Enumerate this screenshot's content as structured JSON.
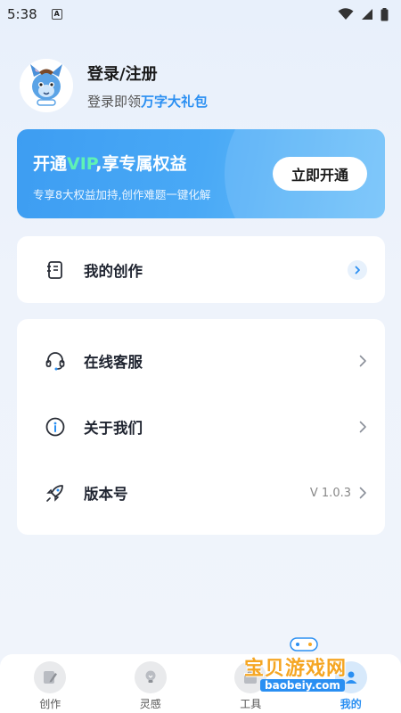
{
  "status_bar": {
    "time": "5:38",
    "notification_icon": "A"
  },
  "profile": {
    "title": "登录/注册",
    "subtitle_prefix": "登录即领",
    "subtitle_highlight": "万字大礼包"
  },
  "vip_card": {
    "title_prefix": "开通",
    "title_vip": "VIP",
    "title_suffix": ",享专属权益",
    "description": "专享8大权益加持,创作难题一键化解",
    "button_label": "立即开通"
  },
  "menu_primary": [
    {
      "label": "我的创作",
      "icon": "notebook-icon"
    }
  ],
  "menu_secondary": [
    {
      "label": "在线客服",
      "icon": "headset-icon"
    },
    {
      "label": "关于我们",
      "icon": "info-icon"
    },
    {
      "label": "版本号",
      "icon": "rocket-icon",
      "value": "V 1.0.3"
    }
  ],
  "tabs": [
    {
      "label": "创作",
      "icon": "edit-icon"
    },
    {
      "label": "灵感",
      "icon": "lightbulb-icon"
    },
    {
      "label": "工具",
      "icon": "toolbox-icon"
    },
    {
      "label": "我的",
      "icon": "user-icon",
      "active": true
    }
  ],
  "watermark": {
    "main": "宝贝游戏网",
    "sub": "baobeiy.com"
  },
  "colors": {
    "accent": "#2a8ff2",
    "vip_green": "#5ff2b4"
  }
}
